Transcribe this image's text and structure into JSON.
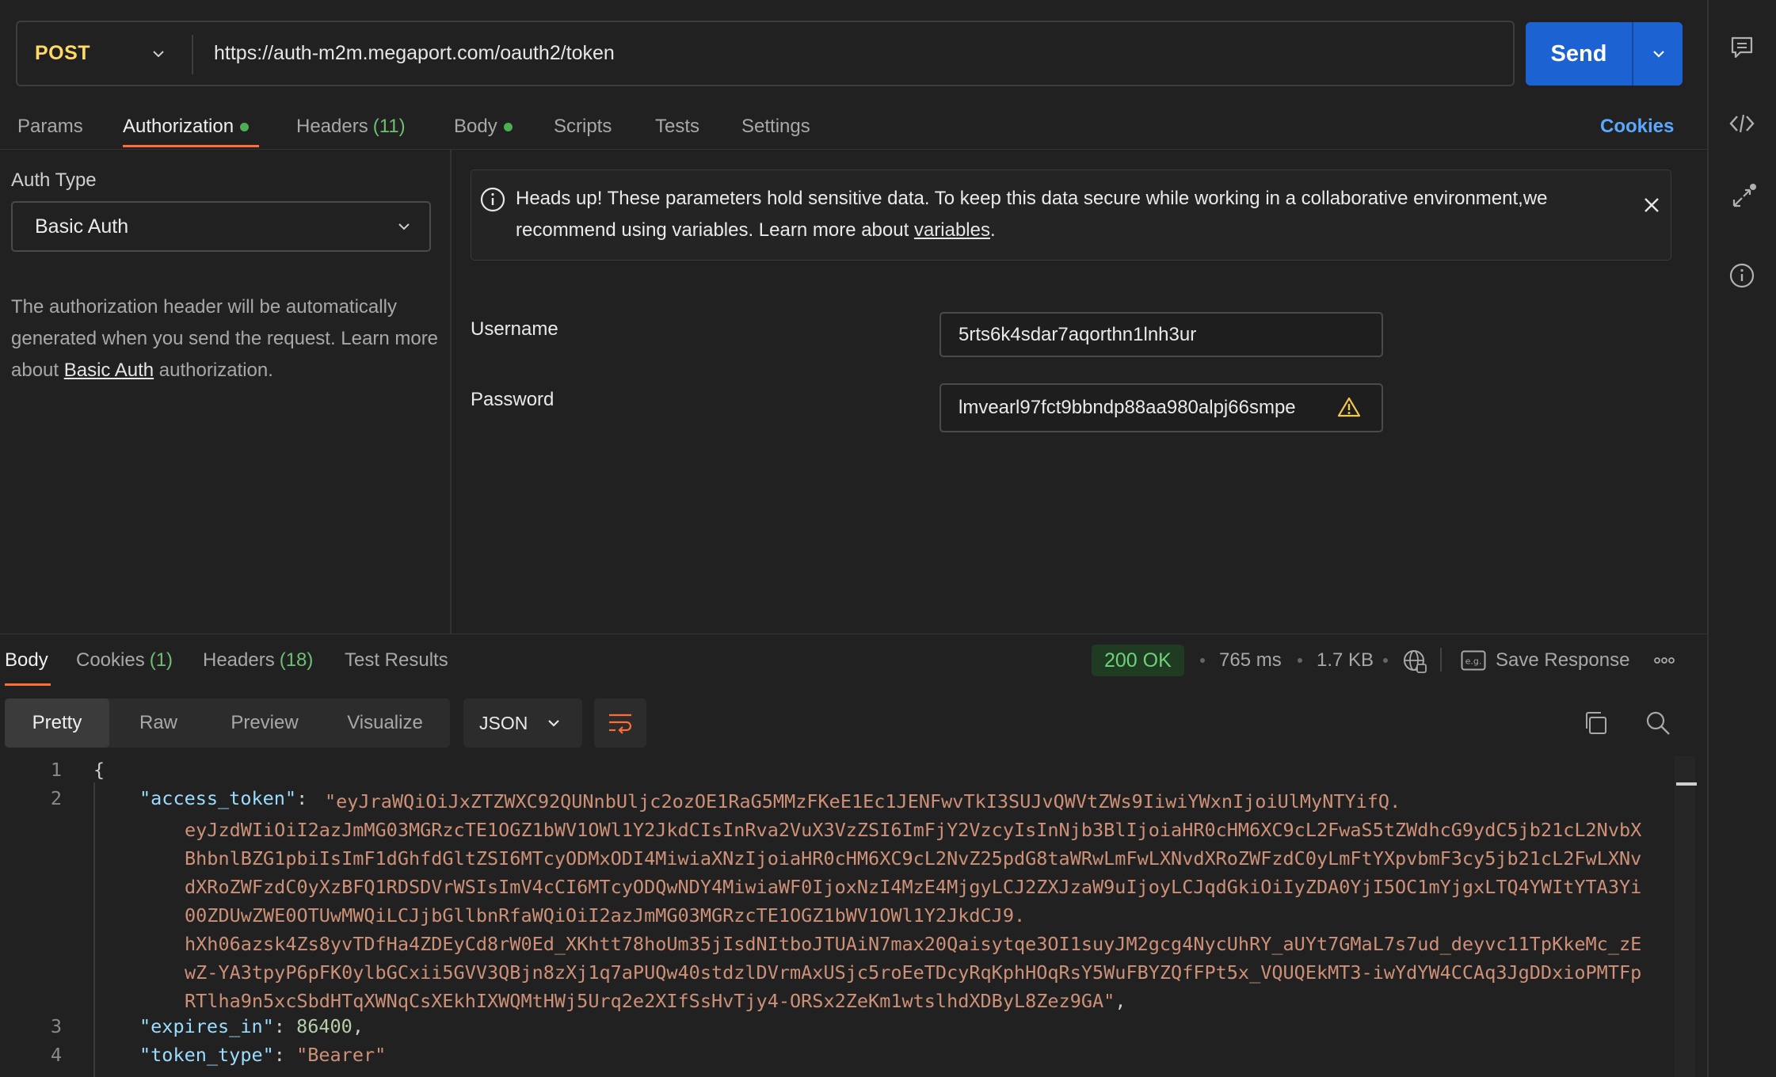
{
  "request": {
    "method": "POST",
    "url": "https://auth-m2m.megaport.com/oauth2/token",
    "send_label": "Send"
  },
  "request_tabs": {
    "params": "Params",
    "authorization": "Authorization",
    "headers": "Headers",
    "headers_count": "(11)",
    "body": "Body",
    "scripts": "Scripts",
    "tests": "Tests",
    "settings": "Settings",
    "cookies": "Cookies"
  },
  "auth": {
    "type_label": "Auth Type",
    "type_value": "Basic Auth",
    "desc_before": "The authorization header will be automatically generated when you send the request. Learn more about ",
    "desc_link": "Basic Auth",
    "desc_after": " authorization.",
    "alert_text": "Heads up! These parameters hold sensitive data. To keep this data secure while working in a collaborative environment,we recommend using variables. Learn more about ",
    "alert_link": "variables",
    "alert_end": ".",
    "username_label": "Username",
    "username_value": "5rts6k4sdar7aqorthn1lnh3ur",
    "password_label": "Password",
    "password_value": "lmvearl97fct9bbndp88aa980alpj66smpe"
  },
  "response_tabs": {
    "body": "Body",
    "cookies": "Cookies",
    "cookies_count": "(1)",
    "headers": "Headers",
    "headers_count": "(18)",
    "test_results": "Test Results"
  },
  "response_meta": {
    "status": "200 OK",
    "time": "765 ms",
    "size": "1.7 KB",
    "save_label": "Save Response",
    "status_color": "#6fd17a"
  },
  "view_modes": [
    "Pretty",
    "Raw",
    "Preview",
    "Visualize"
  ],
  "format": "JSON",
  "code": {
    "line_numbers": [
      "1",
      "2",
      "3",
      "4"
    ],
    "open_brace": "{",
    "access_token_key": "\"access_token\"",
    "access_token_value": "\"eyJraWQiOiJxZTZWXC92QUNnbUljc2ozOE1RaG5MMzFKeE1Ec1JENFwvTkI3SUJvQWVtZWs9IiwiYWxnIjoiUlMyNTYifQ.\neyJzdWIiOiI2azJmMG03MGRzcTE1OGZ1bWV1OWl1Y2JkdCIsInRva2VuX3VzZSI6ImFjY2VzcyIsInNjb3BlIjoiaHR0cHM6XC9cL2FwaS5tZWdhcG9ydC5jb21cL2NvbX\nBhbnlBZG1pbiIsImF1dGhfdGltZSI6MTcyODMxODI4MiwiaXNzIjoiaHR0cHM6XC9cL2NvZ25pdG8taWRwLmFwLXNvdXRoZWFzdC0yLmFtYXpvbmF3cy5jb21cL2FwLXNv\ndXRoZWFzdC0yXzBFQ1RDSDVrWSIsImV4cCI6MTcyODQwNDY4MiwiaWF0IjoxNzI4MzE4MjgyLCJ2ZXJzaW9uIjoyLCJqdGkiOiIyZDA0YjI5OC1mYjgxLTQ4YWItYTA3Yi\n00ZDUwZWE0OTUwMWQiLCJjbGllbnRfaWQiOiI2azJmMG03MGRzcTE1OGZ1bWV1OWl1Y2JkdCJ9.\nhXh06azsk4Zs8yvTDfHa4ZDEyCd8rW0Ed_XKhtt78hoUm35jIsdNItboJTUAiN7max20Qaisytqe3OI1suyJM2gcg4NycUhRY_aUYt7GMaL7s7ud_deyvc11TpKkeMc_zE\nwZ-YA3tpyP6pFK0ylbGCxii5GVV3QBjn8zXj1q7aPUQw40stdzlDVrmAxUSjc5roEeTDcyRqKphHOqRsY5WuFBYZQfFPt5x_VQUQEkMT3-iwYdYW4CCAq3JgDDxioPMTFp\nRTlha9n5xcSbdHTqXWNqCsXEkhIXWQMtHWj5Urq2e2XIfSsHvTjy4-ORSx2ZeKm1wtslhdXDByL8Zez9GA\"",
    "expires_in_key": "\"expires_in\"",
    "expires_in_value": "86400",
    "token_type_key": "\"token_type\"",
    "token_type_value": "\"Bearer\""
  }
}
